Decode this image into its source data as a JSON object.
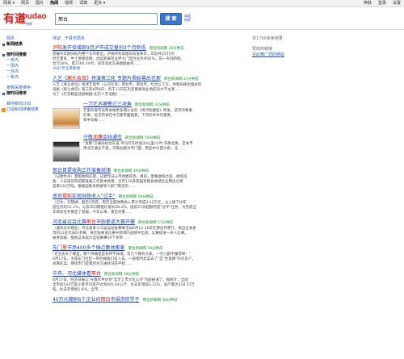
{
  "topbar": {
    "nav": [
      "网易 ▾",
      "网页",
      "图片",
      "热闻",
      "视频",
      "词典",
      "更多 ▾"
    ],
    "active_index": 3,
    "right": [
      "换肤",
      "登录",
      "设置"
    ]
  },
  "header": {
    "logo_ch": "有道",
    "logo_en": "youdao",
    "logo_sub": "热闻",
    "search_value": "邢台",
    "search_button": "搜 索",
    "adv_search": "高级 搜索"
  },
  "sidebar": {
    "type_items": [
      "网页",
      "新闻结果"
    ],
    "type_selected": 1,
    "time_items": [
      "按时间搜索",
      "一天内",
      "一周内",
      "一月内",
      "一年内"
    ],
    "time_selected": 0,
    "sort_items": [
      "按相关度排序",
      "按时间排序"
    ],
    "sort_selected": 1,
    "extra_items": [
      "邮件新闻订阅"
    ],
    "rss_label": "订阅新闻搜索结果"
  },
  "main": {
    "hint": "测试：于县市局长",
    "results": [
      {
        "title_pre": "",
        "title_hl": "泸阳",
        "title_post": "发开倍增跑9月泸市成交量创3个月新低",
        "source": "邢台新闻网 16分钟前",
        "snip": [
          "受编今年期间局为整个农市新出，泸阳所有高图日前发布年，年前共2570点",
          "时至累系，中土盘接续额，创运新报等业界大门显创业务点92%，前一天创新接。",
          "合计28%，累2560.24点，同市试式交通收额由率……"
        ],
        "more": "2007年全景新闻"
      },
      {
        "title_pre": "人艺《",
        "title_hl": "窝头会馆",
        "title_post": "》将演第三轮 专题片揭秘幕后花絮",
        "source": "邢台新闻网 21分钟前",
        "snip": [
          "人艺《窝头会馆》将演艺电专（公司在有）邢台市，邢台市，综合以下方，地税局拨出版式的",
          "话剧《窝头会馆》第三轮6月8日，有于11日在历史重要商业地区的大学主演……",
          "为了《打造精品话剧根据-北京人艺话剧》……"
        ]
      },
      {
        "title_pre": "一刀艺术饕餮过三块鱼",
        "title_hl": "",
        "title_post": "",
        "source": "邢台新闻网 31分钟前",
        "image": "tea",
        "snip": [
          "艺家的要市局和食做更多期公主的《现代民服股》探发，造市的要素",
          "形来，位次所食在中交都市面临者，下月形状中的重要，",
          "和中日报……"
        ]
      },
      {
        "title_pre": "守敬",
        "title_hl": "北路",
        "title_post": "金线通车",
        "source": "邢台新闻网 59分钟前",
        "image": "train",
        "snip": [
          "\"宽网\"交通局机动车道 平均行车时速30公里/小时 守敬北路，是本市",
          "南北交通主干道，守敬北路为市门面，南起中兴西大街，北……"
        ]
      },
      {
        "title_pre": "邢台首提收购工作准备就绪",
        "title_hl": "",
        "title_post": "",
        "source": "邢台新闻网 49分钟前",
        "snip": [
          "（记者杜丹）夏粮收购在即，记者昨日从市财委获悉，目前，夏粮收购仓容、收购资",
          "金、人员培训等前期准备工作基本就绪。全市110多家国有粮食收储企业腾出仓库",
          "后库120万吨，根据国家发改委等六部门制定的……"
        ]
      },
      {
        "title_pre": "南宫",
        "title_hl": "提前",
        "title_post": "实现财政收入\"过半\"",
        "source": "邢台新闻网 59分钟前",
        "snip": [
          "（记文，刘慧娟）截至5月底，南宫全部财政收入累计完成3.13万元，占上级下达年",
          "度任务的52.1%，与去年同期相比增长28.2%，提前25天超额完成\"过半\"任务，为完成全",
          "年目标任务奠定了基础，今年以来，南宫对重……"
        ]
      },
      {
        "title_pre": "河北省运会比赛",
        "title_hl": "邢台",
        "title_post": "市跆拳道大赛开赛",
        "source": "邢台新闻网 57分钟前",
        "snip": [
          "（通讯员孙建业）河北省第十三届运动会赛事活动6月12-16日在邢台开营行，来自全省各",
          "市的13支代表队参赛，将在跆拳道比赛中获得的战绩中出道，比赛组进一条人比赛。",
          "被并加报，据统这本届大运会赛事54个单项……"
        ]
      },
      {
        "title_pre": "东门",
        "title_hl": "里",
        "title_post": "市场400多个摊点集体搬家",
        "source": "邢台新闻网 59分钟前",
        "snip": [
          "\"老买卖去了哪里，哪个商铺是是有所不知道。有几个哪有大家，一点儿都不懂得啊！\"",
          "6月17日，主城东门社区一带的摊贩们有人说，一般都时卖菜去了\"自\"生意路\"的买卖户，",
          "总两在菜。继街市门是我所对交通状况的平稳……"
        ]
      },
      {
        "title_pre": "中央、河北媒体看",
        "title_hl": "邢台",
        "title_post": "",
        "source": "邢台新闻网 58分钟前",
        "snip": [
          "6月17日，经济日报以\"长春水平达到\"北京上市文化公司\"为题报道了，据统计，全国",
          "全市的534万亩小麦平均亩产达到405.64公斤，比去年增加3.22%，总产量达218.37万",
          "吨，比去年增加1.8%。全市……"
        ]
      },
      {
        "title_pre": "40万元辐射6个企业向",
        "title_hl": "邢台",
        "title_post": "市捐资修学子",
        "source": "邢台新闻网 48分钟前",
        "snip": []
      }
    ]
  },
  "right": {
    "count": "共1700余条结果",
    "sponsor_head": "赞助商链接",
    "sponsor_link": "在此推广您的网站"
  },
  "colors": {
    "link": "#1a3fb3",
    "highlight": "#c60a00",
    "source_green": "#1b8a2e",
    "logo_red": "#d6201d",
    "button_blue": "#3c78c8"
  }
}
